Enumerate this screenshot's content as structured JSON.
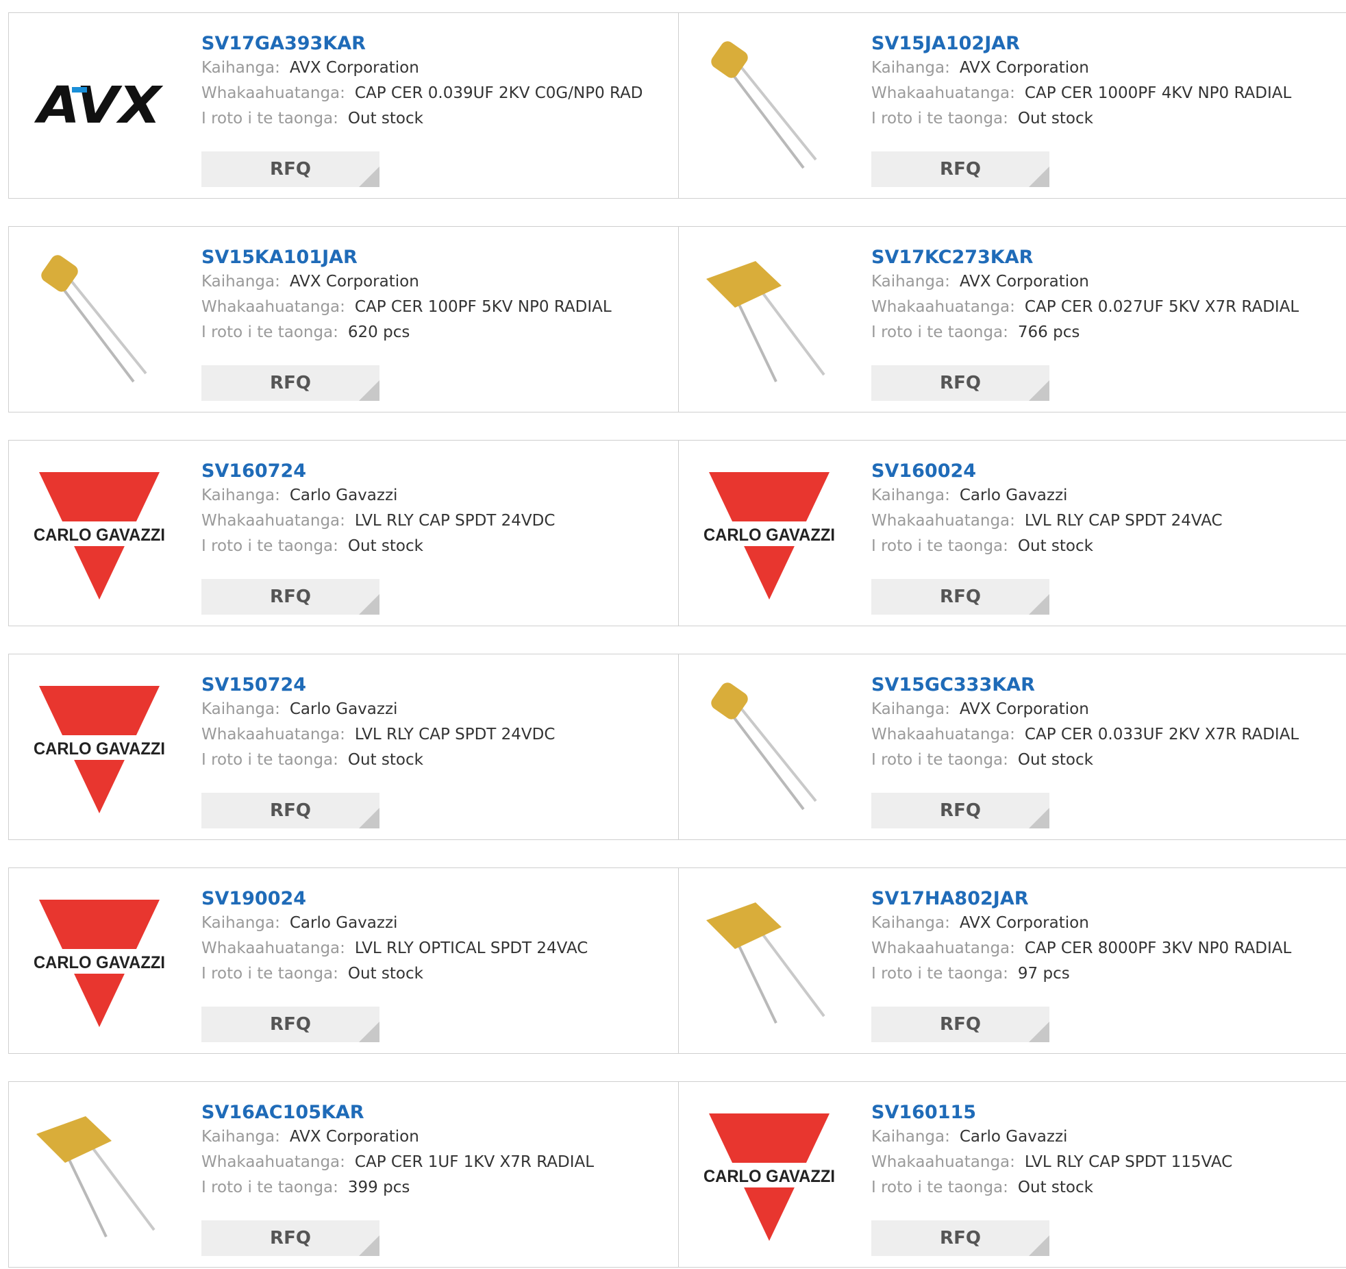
{
  "labels": {
    "manufacturer": "Kaihanga:",
    "description": "Whakaahuatanga:",
    "stock": "I roto i te taonga:",
    "rfq": "RFQ"
  },
  "brand_colors": {
    "link": "#1f6bb8",
    "carlo_red": "#e8362f",
    "capacitor_yellow": "#d9ad3a",
    "avx_blue": "#1a8fd8"
  },
  "products": [
    {
      "part": "SV17GA393KAR",
      "manufacturer": "AVX Corporation",
      "description": "CAP CER 0.039UF 2KV C0G/NP0 RAD",
      "stock": "Out stock",
      "image": "avx-logo",
      "logo_text": "AVX"
    },
    {
      "part": "SV15JA102JAR",
      "manufacturer": "AVX Corporation",
      "description": "CAP CER 1000PF 4KV NP0 RADIAL",
      "stock": "Out stock",
      "image": "capacitor-small"
    },
    {
      "part": "SV15KA101JAR",
      "manufacturer": "AVX Corporation",
      "description": "CAP CER 100PF 5KV NP0 RADIAL",
      "stock": "620 pcs",
      "image": "capacitor-small"
    },
    {
      "part": "SV17KC273KAR",
      "manufacturer": "AVX Corporation",
      "description": "CAP CER 0.027UF 5KV X7R RADIAL",
      "stock": "766 pcs",
      "image": "capacitor-large"
    },
    {
      "part": "SV160724",
      "manufacturer": "Carlo Gavazzi",
      "description": "LVL RLY CAP SPDT 24VDC",
      "stock": "Out stock",
      "image": "carlo-gavazzi-logo",
      "logo_text": "CARLO GAVAZZI"
    },
    {
      "part": "SV160024",
      "manufacturer": "Carlo Gavazzi",
      "description": "LVL RLY CAP SPDT 24VAC",
      "stock": "Out stock",
      "image": "carlo-gavazzi-logo",
      "logo_text": "CARLO GAVAZZI"
    },
    {
      "part": "SV150724",
      "manufacturer": "Carlo Gavazzi",
      "description": "LVL RLY CAP SPDT 24VDC",
      "stock": "Out stock",
      "image": "carlo-gavazzi-logo",
      "logo_text": "CARLO GAVAZZI"
    },
    {
      "part": "SV15GC333KAR",
      "manufacturer": "AVX Corporation",
      "description": "CAP CER 0.033UF 2KV X7R RADIAL",
      "stock": "Out stock",
      "image": "capacitor-small"
    },
    {
      "part": "SV190024",
      "manufacturer": "Carlo Gavazzi",
      "description": "LVL RLY OPTICAL SPDT 24VAC",
      "stock": "Out stock",
      "image": "carlo-gavazzi-logo",
      "logo_text": "CARLO GAVAZZI"
    },
    {
      "part": "SV17HA802JAR",
      "manufacturer": "AVX Corporation",
      "description": "CAP CER 8000PF 3KV NP0 RADIAL",
      "stock": "97 pcs",
      "image": "capacitor-large"
    },
    {
      "part": "SV16AC105KAR",
      "manufacturer": "AVX Corporation",
      "description": "CAP CER 1UF 1KV X7R RADIAL",
      "stock": "399 pcs",
      "image": "capacitor-large"
    },
    {
      "part": "SV160115",
      "manufacturer": "Carlo Gavazzi",
      "description": "LVL RLY CAP SPDT 115VAC",
      "stock": "Out stock",
      "image": "carlo-gavazzi-logo",
      "logo_text": "CARLO GAVAZZI"
    }
  ]
}
